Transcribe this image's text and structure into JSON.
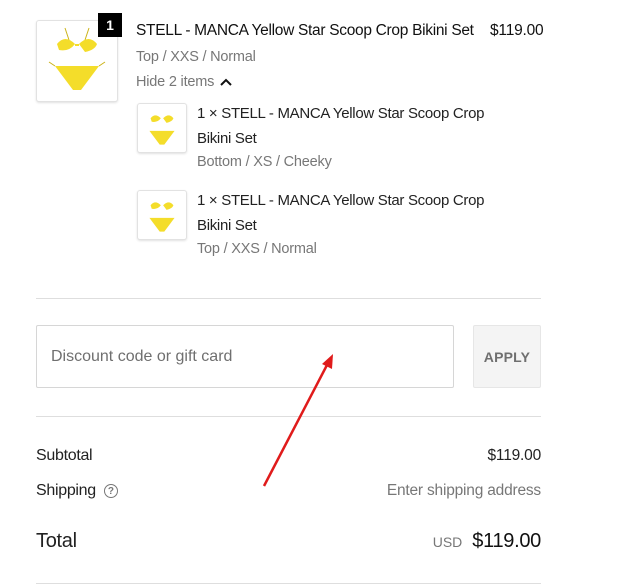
{
  "line_item": {
    "quantity_badge": "1",
    "title": "STELL - MANCA Yellow Star Scoop Crop Bikini Set",
    "variant": "Top / XXS / Normal",
    "price": "$119.00",
    "toggle_label": "Hide 2 items"
  },
  "sub_items": [
    {
      "title_line1": "1 × STELL - MANCA Yellow Star Scoop Crop",
      "title_line2": "Bikini Set",
      "variant": "Bottom / XS / Cheeky"
    },
    {
      "title_line1": "1 × STELL - MANCA Yellow Star Scoop Crop",
      "title_line2": "Bikini Set",
      "variant": "Top / XXS / Normal"
    }
  ],
  "discount": {
    "placeholder": "Discount code or gift card",
    "value": "",
    "apply_label": "APPLY"
  },
  "summary": {
    "subtotal_label": "Subtotal",
    "subtotal_value": "$119.00",
    "shipping_label": "Shipping",
    "shipping_value": "Enter shipping address",
    "total_label": "Total",
    "currency": "USD",
    "total_value": "$119.00"
  },
  "colors": {
    "bikini_yellow": "#f4dd2a",
    "annotation_arrow": "#e01b1b"
  }
}
